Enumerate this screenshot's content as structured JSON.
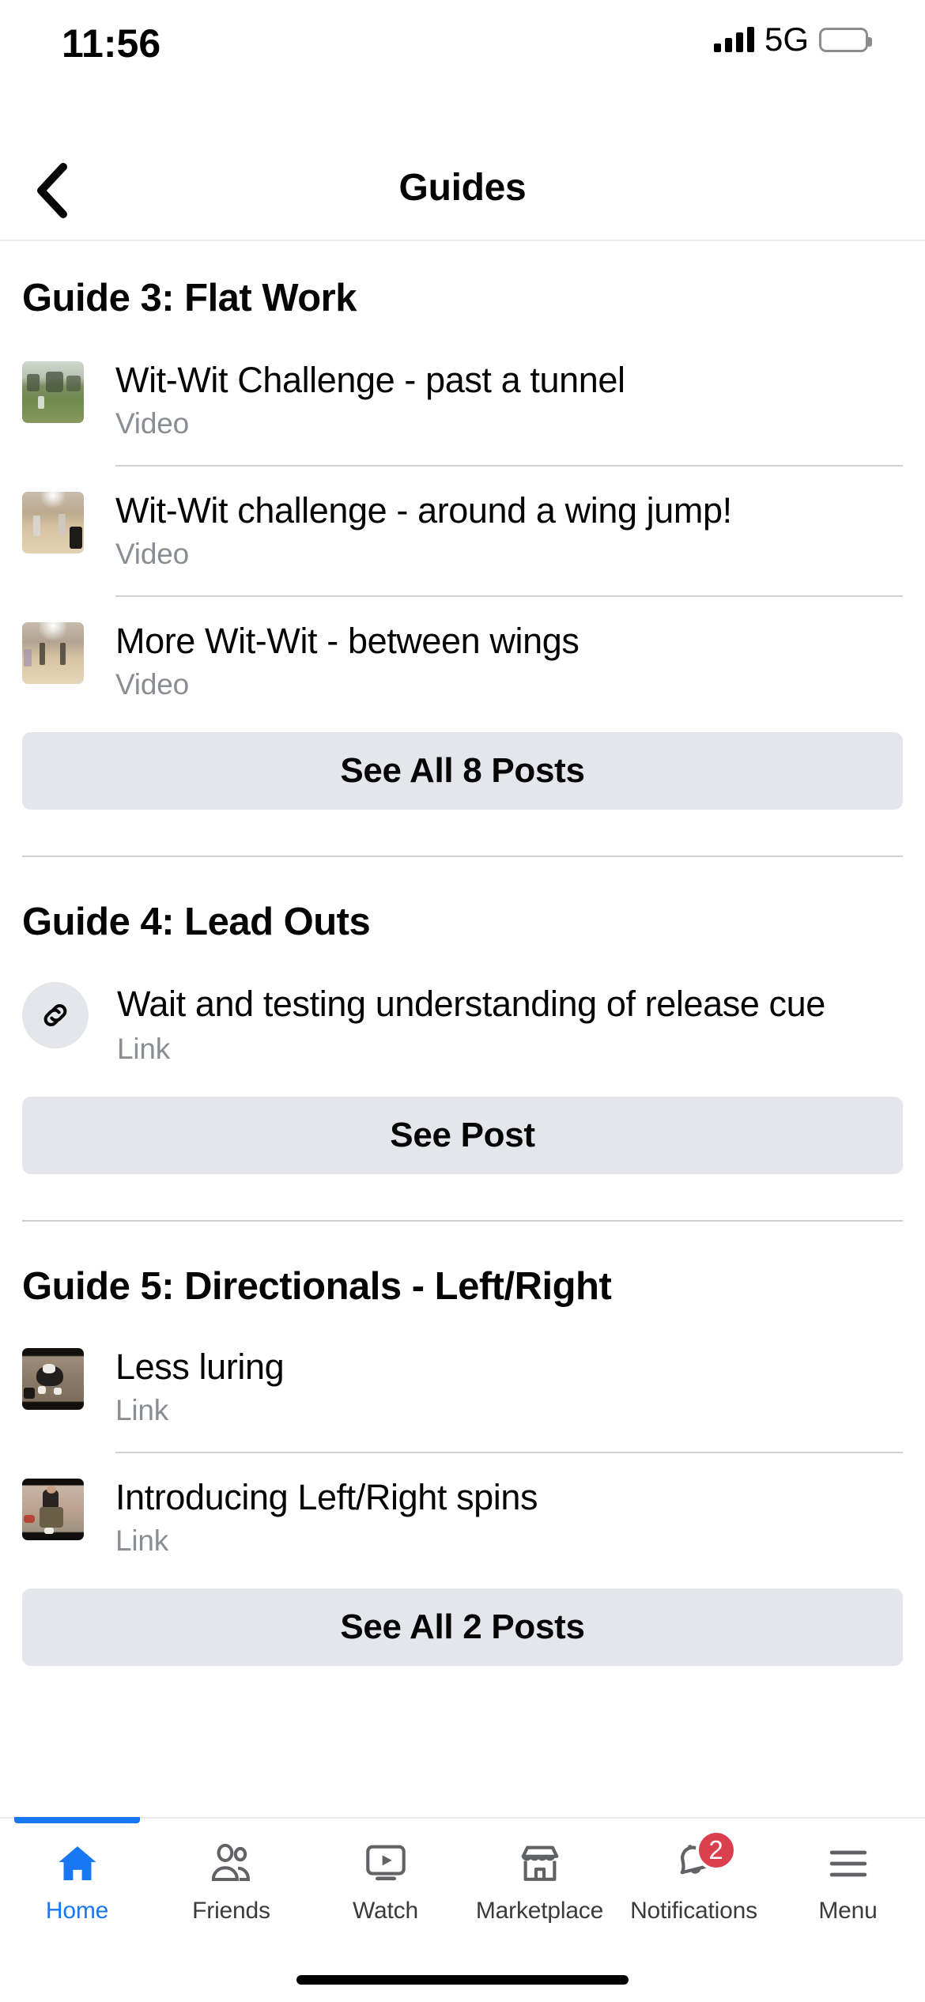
{
  "status_bar": {
    "time": "11:56",
    "network": "5G",
    "signal_icon": "cellular-bars-icon",
    "battery_icon": "battery-icon"
  },
  "header": {
    "title": "Guides",
    "back_icon": "chevron-left-icon"
  },
  "colors": {
    "accent": "#1877f2",
    "badge": "#d93f4c",
    "button_bg": "#e4e6eb",
    "divider": "#ced0d4",
    "secondary_text": "#8a8d91",
    "primary_text": "#050505"
  },
  "sections": [
    {
      "title": "Guide 3: Flat Work",
      "items": [
        {
          "title": "Wit-Wit Challenge - past a tunnel",
          "type": "Video",
          "media": "thumbnail-outdoor-field"
        },
        {
          "title": "Wit-Wit challenge - around a wing jump!",
          "type": "Video",
          "media": "thumbnail-indoor-hall"
        },
        {
          "title": "More Wit-Wit - between wings",
          "type": "Video",
          "media": "thumbnail-indoor-wings"
        }
      ],
      "cta": "See All 8 Posts"
    },
    {
      "title": "Guide 4: Lead Outs",
      "items": [
        {
          "title": "Wait and testing understanding of release cue",
          "type": "Link",
          "media": "link-icon"
        }
      ],
      "cta": "See Post"
    },
    {
      "title": "Guide 5: Directionals - Left/Right",
      "items": [
        {
          "title": "Less luring",
          "type": "Link",
          "media": "thumbnail-dog-floor"
        },
        {
          "title": "Introducing Left/Right spins",
          "type": "Link",
          "media": "thumbnail-person-crouch"
        }
      ],
      "cta": "See All 2 Posts"
    }
  ],
  "tabbar": {
    "items": [
      {
        "label": "Home",
        "icon": "home-icon",
        "active": true,
        "badge": ""
      },
      {
        "label": "Friends",
        "icon": "friends-icon",
        "active": false,
        "badge": ""
      },
      {
        "label": "Watch",
        "icon": "watch-icon",
        "active": false,
        "badge": ""
      },
      {
        "label": "Marketplace",
        "icon": "marketplace-icon",
        "active": false,
        "badge": ""
      },
      {
        "label": "Notifications",
        "icon": "bell-icon",
        "active": false,
        "badge": "2"
      },
      {
        "label": "Menu",
        "icon": "hamburger-menu-icon",
        "active": false,
        "badge": ""
      }
    ]
  }
}
